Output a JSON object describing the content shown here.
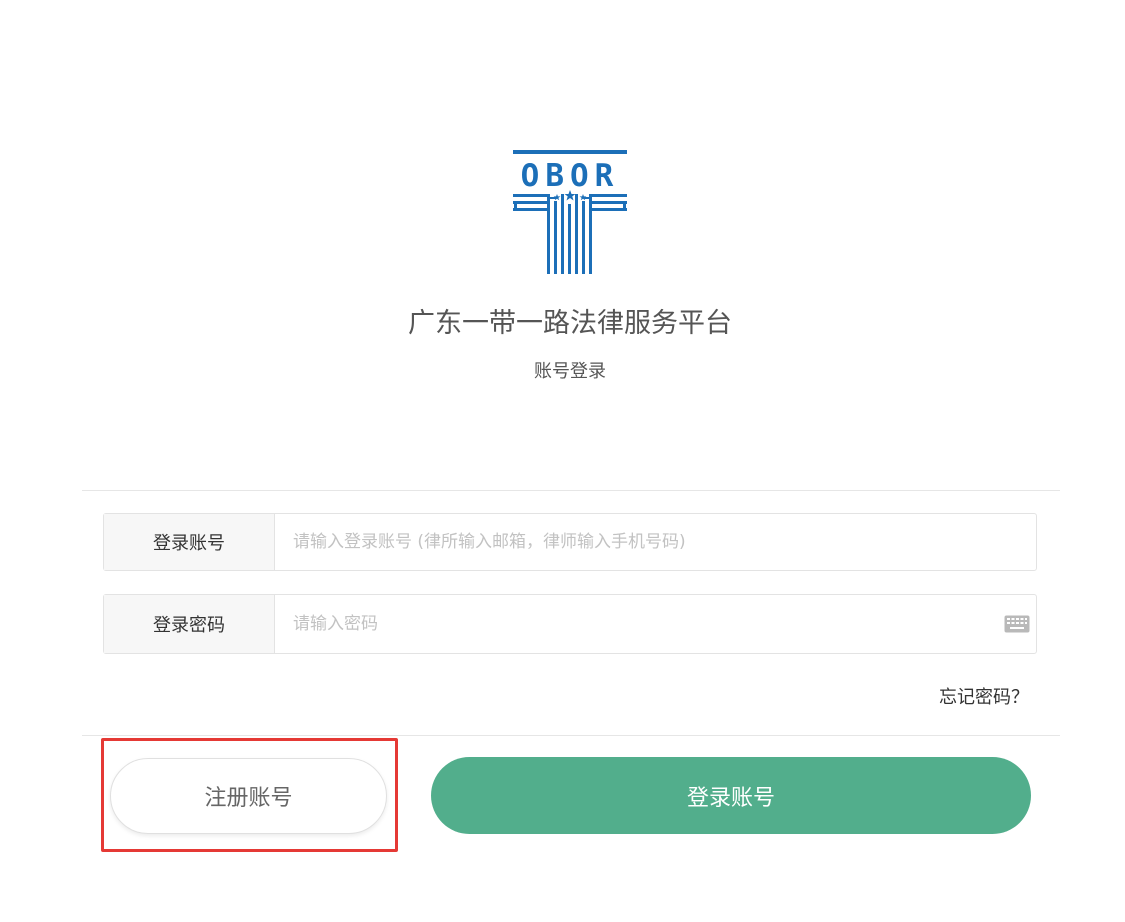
{
  "brand": {
    "logo_text": "OBOR",
    "logo_color": "#1c6fb8",
    "site_title": "广东一带一路法律服务平台",
    "login_subtitle": "账号登录"
  },
  "form": {
    "account_label": "登录账号",
    "account_placeholder": "请输入登录账号 (律所输入邮箱，律师输入手机号码)",
    "account_value": "",
    "password_label": "登录密码",
    "password_placeholder": "请输入密码",
    "password_value": "",
    "keyboard_icon": "keyboard-icon",
    "forgot_password": "忘记密码？"
  },
  "actions": {
    "register_label": "注册账号",
    "login_label": "登录账号",
    "login_color": "#52ae8c",
    "highlight_color": "#e53935"
  }
}
